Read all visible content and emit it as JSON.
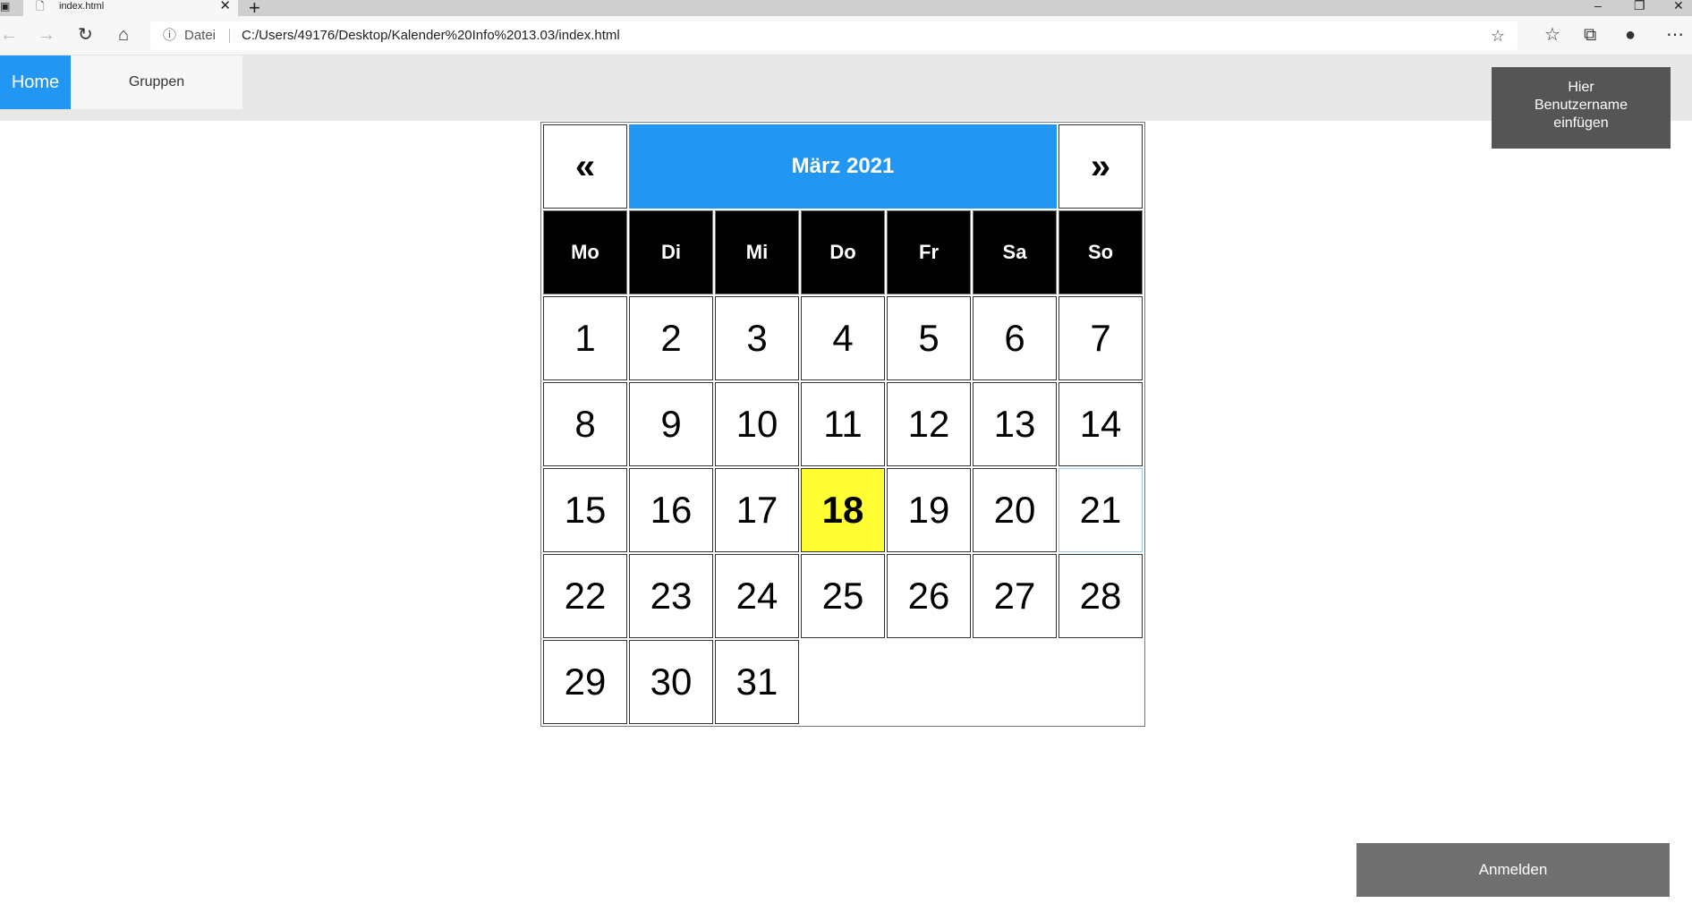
{
  "browser": {
    "tab_title": "index.html",
    "address_scheme": "Datei",
    "address_url": "C:/Users/49176/Desktop/Kalender%20Info%2013.03/index.html"
  },
  "nav": {
    "home_label": "Home",
    "groups_label": "Gruppen"
  },
  "user": {
    "line1": "Hier",
    "line2": "Benutzername",
    "line3": "einfügen"
  },
  "calendar": {
    "prev_label": "«",
    "next_label": "»",
    "month_title": "März 2021",
    "weekdays": [
      "Mo",
      "Di",
      "Mi",
      "Do",
      "Fr",
      "Sa",
      "So"
    ],
    "days": [
      "1",
      "2",
      "3",
      "4",
      "5",
      "6",
      "7",
      "8",
      "9",
      "10",
      "11",
      "12",
      "13",
      "14",
      "15",
      "16",
      "17",
      "18",
      "19",
      "20",
      "21",
      "22",
      "23",
      "24",
      "25",
      "26",
      "27",
      "28",
      "29",
      "30",
      "31"
    ],
    "today": "18",
    "today_color": "#ffff33",
    "header_color": "#2196f3"
  },
  "login_label": "Anmelden"
}
